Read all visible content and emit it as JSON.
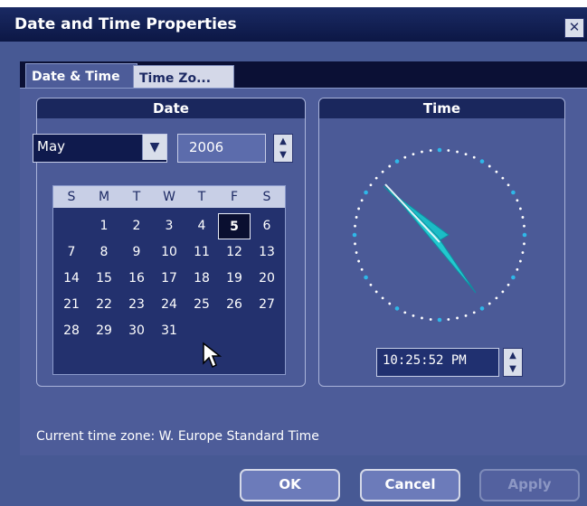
{
  "window": {
    "title": "Date and Time Properties",
    "close": "✕"
  },
  "tabs": [
    "Date & Time",
    "Time Zo..."
  ],
  "date_group": {
    "header": "Date",
    "month": "May",
    "month_arrow": "▼",
    "year": "2006",
    "calendar": {
      "days_of_week": [
        "S",
        "M",
        "T",
        "W",
        "T",
        "F",
        "S"
      ],
      "weeks": [
        [
          "",
          "1",
          "2",
          "3",
          "4",
          "5",
          "6"
        ],
        [
          "7",
          "8",
          "9",
          "10",
          "11",
          "12",
          "13"
        ],
        [
          "14",
          "15",
          "16",
          "17",
          "18",
          "19",
          "20"
        ],
        [
          "21",
          "22",
          "23",
          "24",
          "25",
          "26",
          "27"
        ],
        [
          "28",
          "29",
          "30",
          "31",
          "",
          "",
          ""
        ]
      ],
      "selected_day": "5"
    }
  },
  "time_group": {
    "header": "Time",
    "time": "10:25:52 PM"
  },
  "timezone": "Current time zone: W. Europe Standard Time",
  "buttons": {
    "ok": "OK",
    "cancel": "Cancel",
    "apply": "Apply"
  },
  "icons": {
    "close": "close-icon",
    "dropdown": "chevron-down-icon",
    "spin": "spin-arrows-icon",
    "cursor": "mouse-pointer-icon"
  },
  "colors": {
    "background": "#475994",
    "title_bar": "#1a2a63",
    "clock_hands": "#1bbcc6",
    "clock_dots": "#2fb7e8"
  }
}
